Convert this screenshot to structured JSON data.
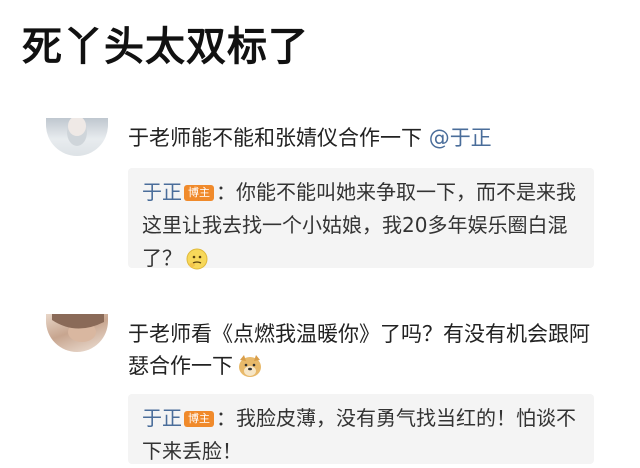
{
  "headline": "死丫头太双标了",
  "comments": [
    {
      "text": "于老师能不能和张婧仪合作一下",
      "mention": "@于正",
      "reply": {
        "author": "于正",
        "badge": "博主",
        "sep": "：",
        "text": "你能不能叫她来争取一下，而不是来我这里让我去找一个小姑娘，我20多年娱乐圈白混了？",
        "emoji": "thinking-face-icon"
      }
    },
    {
      "text": "于老师看《点燃我温暖你》了吗？有没有机会跟阿瑟合作一下",
      "emoji": "doge-icon",
      "reply": {
        "author": "于正",
        "badge": "博主",
        "sep": "：",
        "text": "我脸皮薄，没有勇气找当红的！怕谈不下来丢脸！"
      }
    }
  ],
  "colors": {
    "link": "#4a6d9a",
    "badge": "#f08a2b",
    "reply_bg": "#f4f4f4"
  }
}
